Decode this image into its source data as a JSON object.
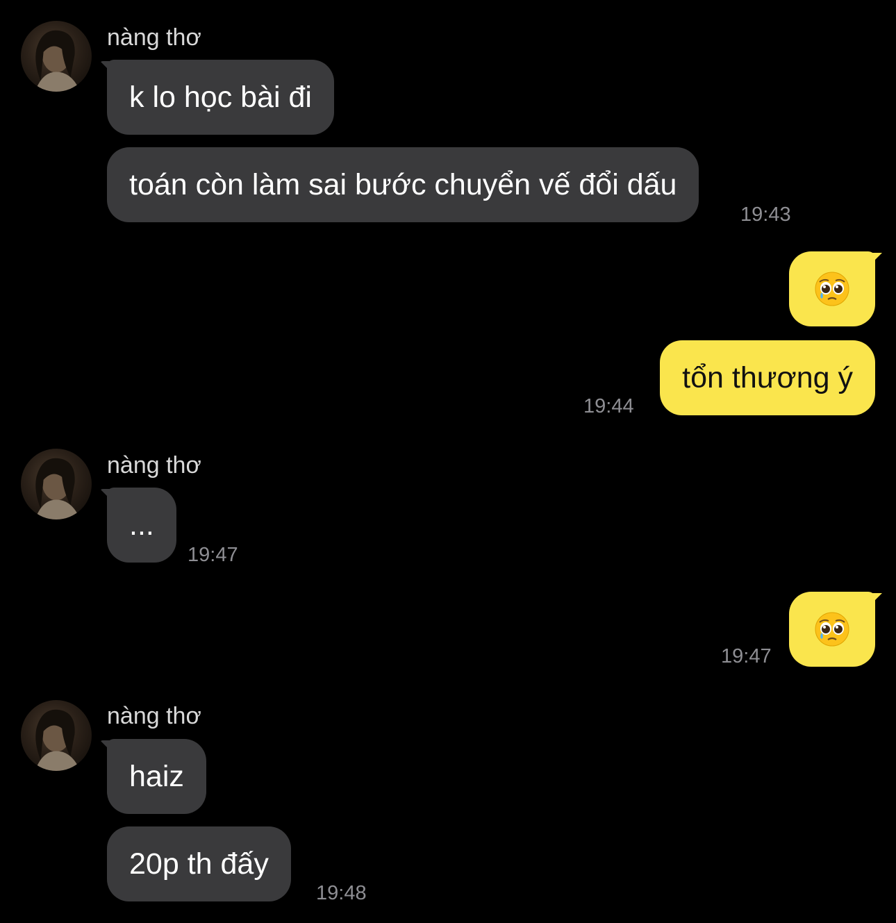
{
  "messages": [
    {
      "sender": "nàng thơ",
      "text": "k lo học bài đi"
    },
    {
      "text": "toán còn làm sai bước chuyển vế đổi dấu",
      "time": "19:43"
    },
    {
      "emoji": "pleading-face"
    },
    {
      "text": "tổn thương ý",
      "time": "19:44"
    },
    {
      "sender": "nàng thơ",
      "text": "...",
      "time": "19:47"
    },
    {
      "emoji": "pleading-face",
      "time": "19:47"
    },
    {
      "sender": "nàng thơ",
      "text": "haiz"
    },
    {
      "text": "20p th đấy",
      "time": "19:48"
    }
  ],
  "colors": {
    "background": "#000000",
    "incoming_bubble": "#3a3a3c",
    "outgoing_bubble": "#fae54d",
    "timestamp": "#8e8e93"
  }
}
